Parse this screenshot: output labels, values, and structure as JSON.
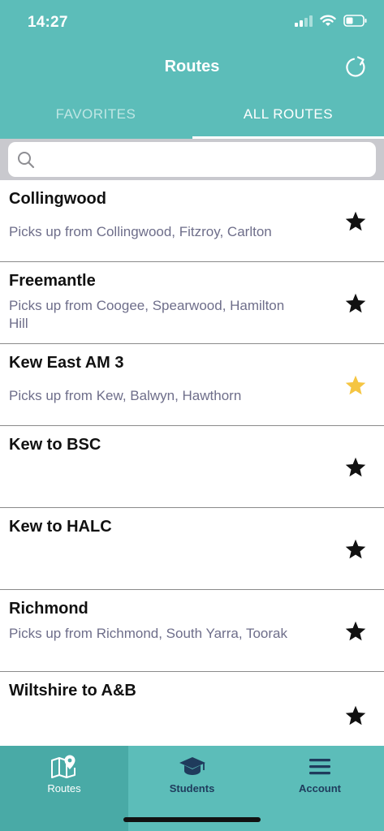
{
  "status_bar": {
    "time": "14:27"
  },
  "header": {
    "title": "Routes"
  },
  "tabs": [
    {
      "label": "FAVORITES",
      "active": false
    },
    {
      "label": "ALL ROUTES",
      "active": true
    }
  ],
  "search": {
    "placeholder": "",
    "value": ""
  },
  "routes": [
    {
      "name": "Collingwood",
      "description": "Picks up from Collingwood, Fitzroy, Carlton",
      "favorite": false
    },
    {
      "name": "Freemantle",
      "description": "Picks up from Coogee, Spearwood, Hamilton Hill",
      "favorite": false
    },
    {
      "name": "Kew East AM 3",
      "description": "Picks up from Kew, Balwyn, Hawthorn",
      "favorite": true
    },
    {
      "name": "Kew to BSC",
      "description": "",
      "favorite": false
    },
    {
      "name": "Kew to HALC",
      "description": "",
      "favorite": false
    },
    {
      "name": "Richmond",
      "description": "Picks up from Richmond, South Yarra, Toorak",
      "favorite": false
    },
    {
      "name": "Wiltshire to A&B",
      "description": "",
      "favorite": false
    }
  ],
  "bottom_nav": [
    {
      "label": "Routes",
      "icon": "map-pin-icon",
      "active": true
    },
    {
      "label": "Students",
      "icon": "graduation-cap-icon",
      "active": false
    },
    {
      "label": "Account",
      "icon": "menu-icon",
      "active": false
    }
  ],
  "colors": {
    "brand": "#5cbdb9",
    "active_nav": "#49aaa6",
    "favorite_star": "#f5c542",
    "star": "#111111"
  }
}
